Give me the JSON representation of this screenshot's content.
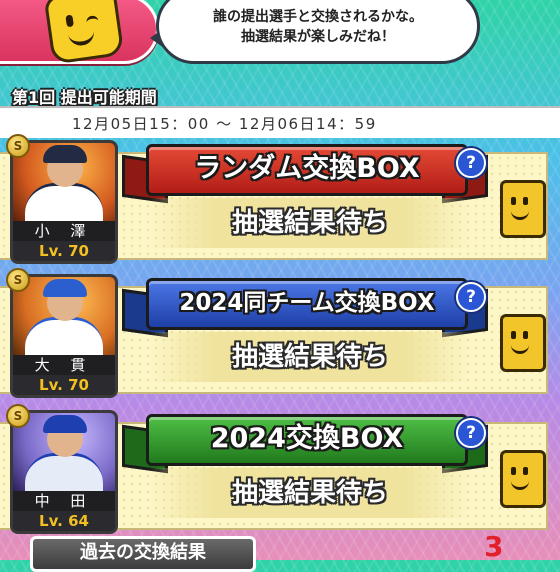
{
  "banner": {
    "speech_line1": "誰の提出選手と交換されるかな。",
    "speech_line2": "抽選結果が楽しみだね！"
  },
  "period": {
    "title": "第1回 提出可能期間",
    "range": "12月05日15：00 ～ 12月06日14：59"
  },
  "exchanges": [
    {
      "box_name": "ランダム交換BOX",
      "ribbon_color": "#c8271f",
      "status": "抽選結果待ち",
      "player": {
        "name": "小 澤",
        "level": "Lv. 70",
        "badge": "S",
        "photo_color": "#d35a1f",
        "uniform_color": "#ffffff",
        "cap_color": "#222a44"
      }
    },
    {
      "box_name": "2024同チーム交換BOX",
      "ribbon_color": "#2b55c9",
      "status": "抽選結果待ち",
      "player": {
        "name": "大 貫",
        "level": "Lv. 70",
        "badge": "S",
        "photo_color": "#d86e22",
        "uniform_color": "#ffffff",
        "cap_color": "#2b5fd0"
      }
    },
    {
      "box_name": "2024交換BOX",
      "ribbon_color": "#2f9a2b",
      "status": "抽選結果待ち",
      "player": {
        "name": "中 田",
        "level": "Lv. 64",
        "badge": "S",
        "photo_color": "#7a6ac8",
        "uniform_color": "#e6ecf7",
        "cap_color": "#1d3fb0"
      }
    }
  ],
  "help_glyph": "?",
  "footer": {
    "past_results_label": "過去の交換結果",
    "right_label": "",
    "count": "3"
  }
}
